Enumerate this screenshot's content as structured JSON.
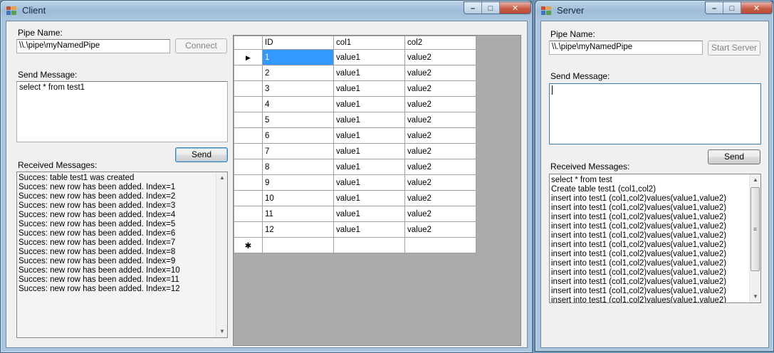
{
  "client": {
    "title": "Client",
    "pipe_name_label": "Pipe Name:",
    "pipe_name_value": "\\\\.\\pipe\\myNamedPipe",
    "connect_label": "Connect",
    "send_message_label": "Send Message:",
    "send_message_value": "select * from test1",
    "send_label": "Send",
    "received_label": "Received Messages:",
    "received_messages": [
      "Succes: table test1 was created",
      "Succes: new row has been added. Index=1",
      "Succes: new row has been added. Index=2",
      "Succes: new row has been added. Index=3",
      "Succes: new row has been added. Index=4",
      "Succes: new row has been added. Index=5",
      "Succes: new row has been added. Index=6",
      "Succes: new row has been added. Index=7",
      "Succes: new row has been added. Index=8",
      "Succes: new row has been added. Index=9",
      "Succes: new row has been added. Index=10",
      "Succes: new row has been added. Index=11",
      "Succes: new row has been added. Index=12"
    ],
    "grid": {
      "columns": [
        "ID",
        "col1",
        "col2"
      ],
      "rows": [
        [
          "1",
          "value1",
          "value2"
        ],
        [
          "2",
          "value1",
          "value2"
        ],
        [
          "3",
          "value1",
          "value2"
        ],
        [
          "4",
          "value1",
          "value2"
        ],
        [
          "5",
          "value1",
          "value2"
        ],
        [
          "6",
          "value1",
          "value2"
        ],
        [
          "7",
          "value1",
          "value2"
        ],
        [
          "8",
          "value1",
          "value2"
        ],
        [
          "9",
          "value1",
          "value2"
        ],
        [
          "10",
          "value1",
          "value2"
        ],
        [
          "11",
          "value1",
          "value2"
        ],
        [
          "12",
          "value1",
          "value2"
        ]
      ],
      "current_row_marker": "▶",
      "new_row_marker": "✱"
    }
  },
  "server": {
    "title": "Server",
    "pipe_name_label": "Pipe Name:",
    "pipe_name_value": "\\\\.\\pipe\\myNamedPipe",
    "start_server_label": "Start Server",
    "send_message_label": "Send Message:",
    "send_message_value": "",
    "send_label": "Send",
    "received_label": "Received Messages:",
    "received_messages": [
      "select * from test",
      "Create table test1 (col1,col2)",
      "insert into test1 (col1,col2)values(value1,value2)",
      "insert into test1 (col1,col2)values(value1,value2)",
      "insert into test1 (col1,col2)values(value1,value2)",
      "insert into test1 (col1,col2)values(value1,value2)",
      "insert into test1 (col1,col2)values(value1,value2)",
      "insert into test1 (col1,col2)values(value1,value2)",
      "insert into test1 (col1,col2)values(value1,value2)",
      "insert into test1 (col1,col2)values(value1,value2)",
      "insert into test1 (col1,col2)values(value1,value2)",
      "insert into test1 (col1,col2)values(value1,value2)",
      "insert into test1 (col1,col2)values(value1,value2)",
      "insert into test1 (col1,col2)values(value1,value2)"
    ]
  },
  "window_controls": {
    "minimize": "–",
    "maximize": "□",
    "close": "✕"
  },
  "icons": {
    "window": "app-window-icon",
    "scroll_up": "▲",
    "scroll_down": "▼",
    "thumb_grip": "≡"
  },
  "colors": {
    "selection": "#3399ff",
    "grid_background": "#ababab",
    "close_button": "#c75a45"
  }
}
